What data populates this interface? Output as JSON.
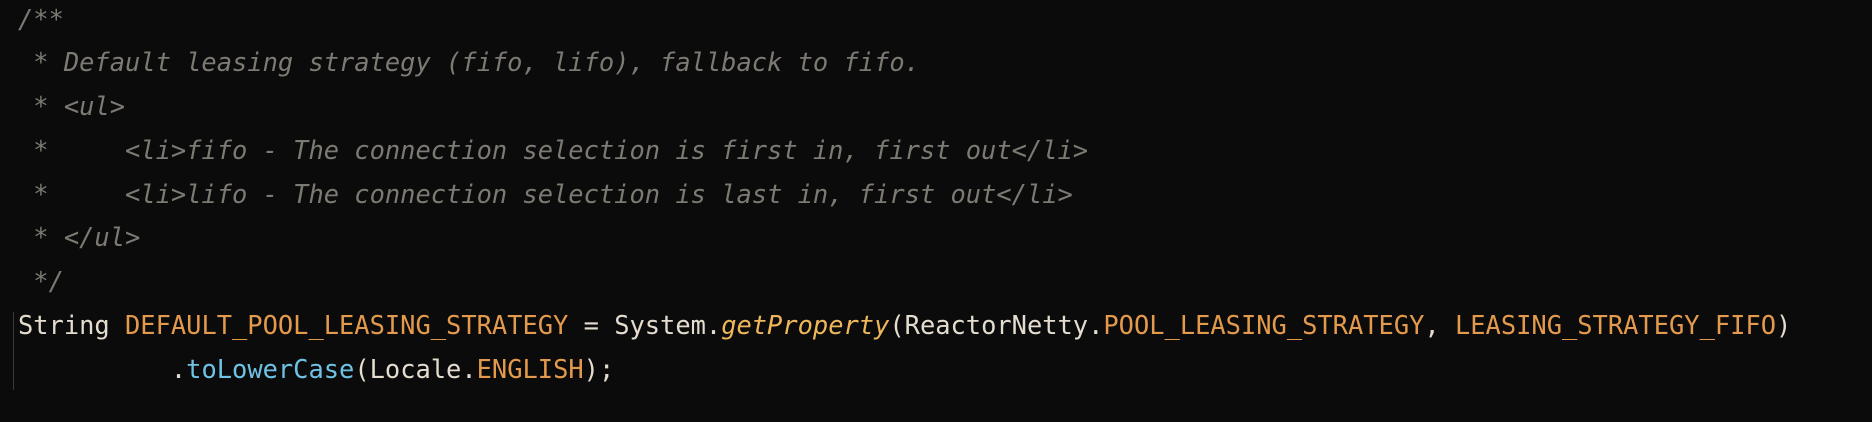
{
  "code": {
    "line1": "/**",
    "line2": " * Default leasing strategy (fifo, lifo), fallback to fifo.",
    "line3": " * <ul>",
    "line4": " *     <li>fifo - The connection selection is first in, first out</li>",
    "line5": " *     <li>lifo - The connection selection is last in, first out</li>",
    "line6": " * </ul>",
    "line7": " */",
    "line8": {
      "type": "String",
      "name": "DEFAULT_POOL_LEASING_STRATEGY",
      "assign": " = ",
      "cls": "System",
      "dot1": ".",
      "method": "getProperty",
      "open": "(",
      "cls2": "ReactorNetty",
      "dot2": ".",
      "const1": "POOL_LEASING_STRATEGY",
      "comma": ", ",
      "const2": "LEASING_STRATEGY_FIFO",
      "close": ")"
    },
    "line9": {
      "indent": "          ",
      "dot": ".",
      "method": "toLowerCase",
      "open": "(",
      "cls": "Locale",
      "dot2": ".",
      "const": "ENGLISH",
      "close": ");"
    }
  },
  "colors": {
    "background": "#0b0b0b",
    "comment": "#7c7a72",
    "plain": "#e4dccf",
    "constant": "#e49a4c",
    "static_method": "#f0b75a",
    "method": "#6fc2e4"
  }
}
